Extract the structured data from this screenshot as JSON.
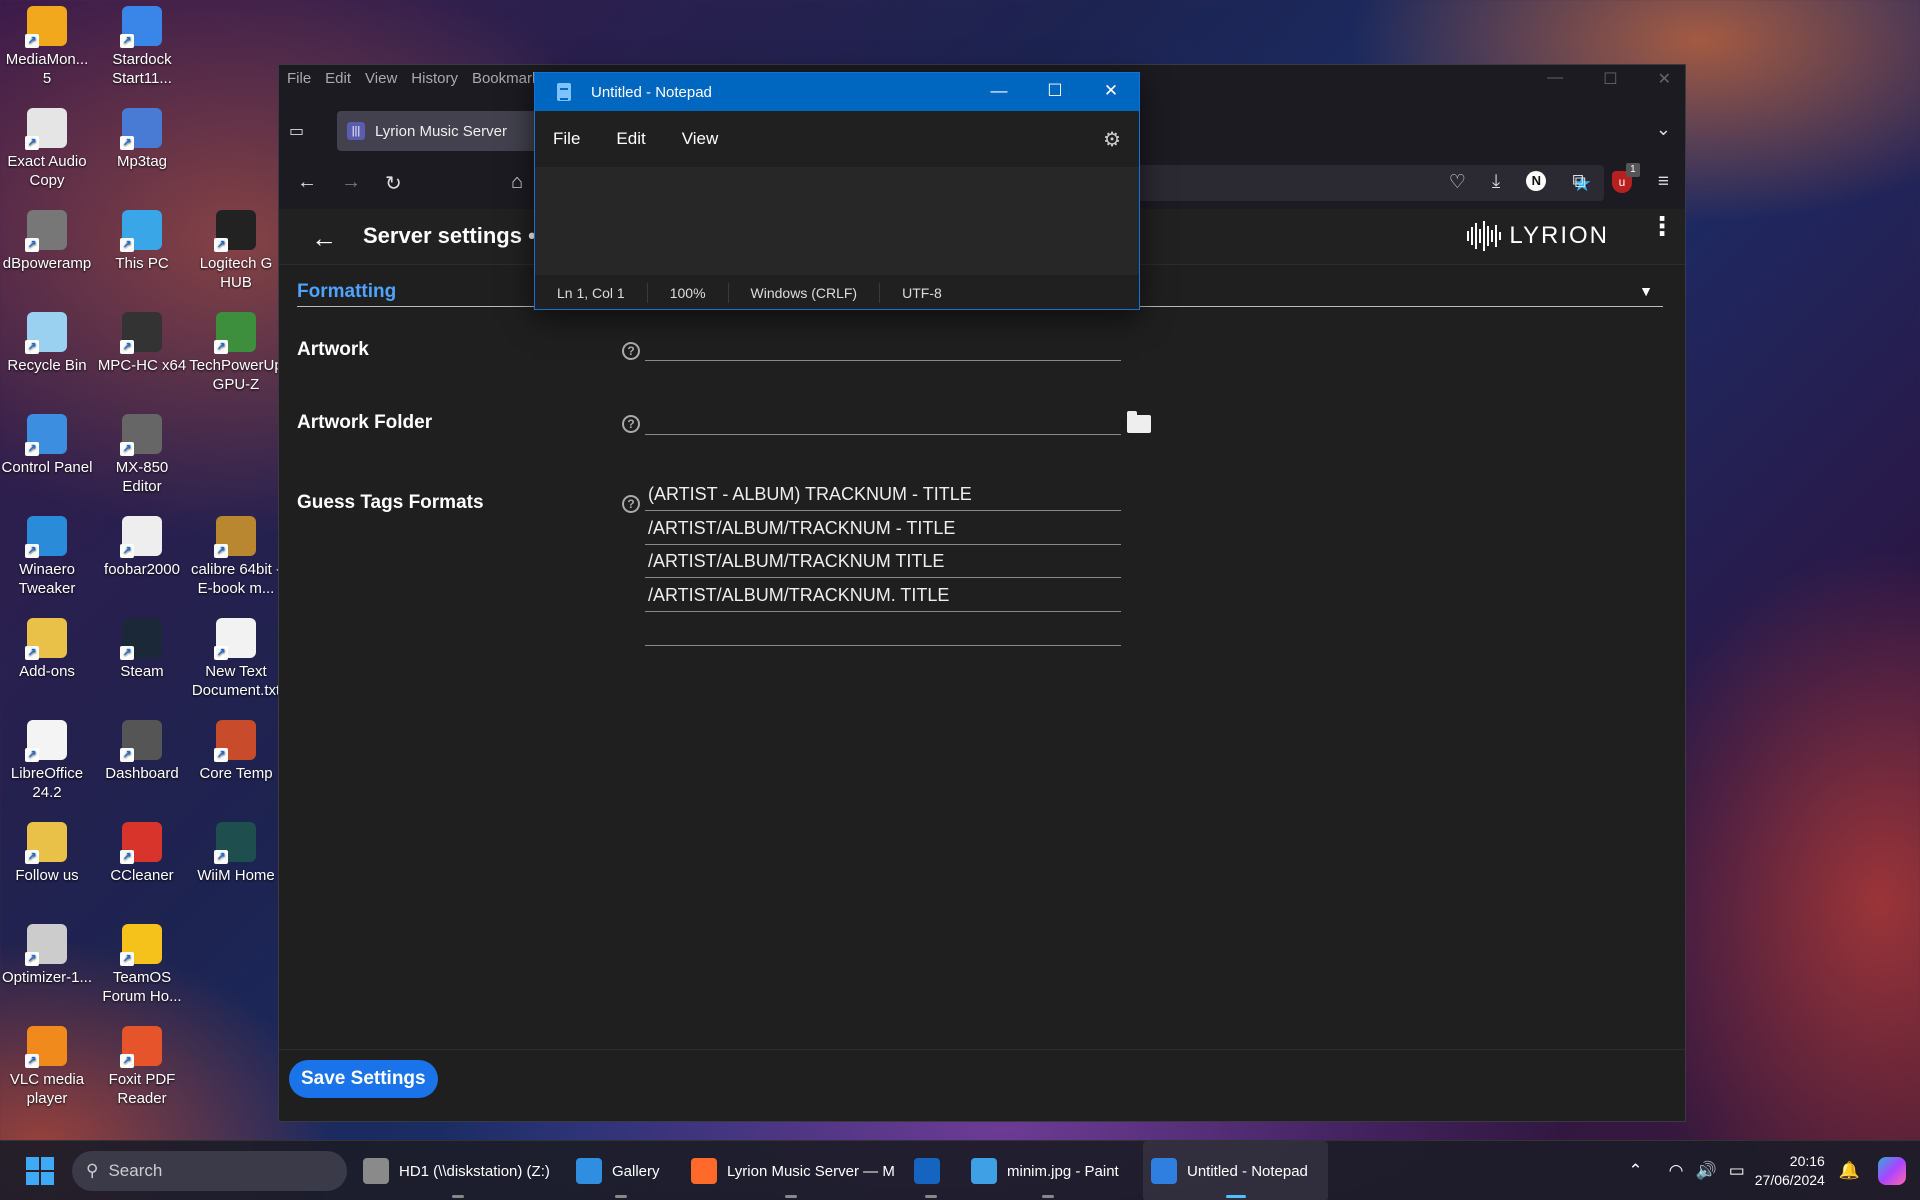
{
  "desktop": {
    "icons": [
      {
        "label": "MediaMon...\n5",
        "name": "mediamonkey",
        "color": "#f2a81d"
      },
      {
        "label": "Stardock Start11...",
        "name": "stardock-start11",
        "color": "#3a86e8"
      },
      {
        "label": "Exact Audio Copy",
        "name": "exact-audio-copy",
        "color": "#e5e5e5"
      },
      {
        "label": "Mp3tag",
        "name": "mp3tag",
        "color": "#4a7bd4"
      },
      {
        "label": "dBpoweramp",
        "name": "dbpoweramp",
        "color": "#777"
      },
      {
        "label": "This PC",
        "name": "this-pc",
        "color": "#39a6e8"
      },
      {
        "label": "Logitech G HUB",
        "name": "logitech-g-hub",
        "color": "#222"
      },
      {
        "label": "Recycle Bin",
        "name": "recycle-bin",
        "color": "#9ad0f0"
      },
      {
        "label": "MPC-HC x64",
        "name": "mpc-hc",
        "color": "#333"
      },
      {
        "label": "TechPowerUp GPU-Z",
        "name": "gpu-z",
        "color": "#3d8f3d"
      },
      {
        "label": "Control Panel",
        "name": "control-panel",
        "color": "#3b8ee0"
      },
      {
        "label": "MX-850 Editor",
        "name": "mx-850-editor",
        "color": "#666"
      },
      {
        "label": "Winaero Tweaker",
        "name": "winaero-tweaker",
        "color": "#2a8bd8"
      },
      {
        "label": "foobar2000",
        "name": "foobar2000",
        "color": "#eee"
      },
      {
        "label": "calibre 64bit - E-book m...",
        "name": "calibre",
        "color": "#b8872f"
      },
      {
        "label": "Add-ons",
        "name": "add-ons",
        "color": "#e9c048"
      },
      {
        "label": "Steam",
        "name": "steam",
        "color": "#1b2838"
      },
      {
        "label": "New Text Document.txt",
        "name": "new-text-document",
        "color": "#f2f2f2"
      },
      {
        "label": "LibreOffice 24.2",
        "name": "libreoffice",
        "color": "#f4f4f4"
      },
      {
        "label": "Dashboard",
        "name": "dashboard",
        "color": "#555"
      },
      {
        "label": "Core Temp",
        "name": "core-temp",
        "color": "#c84b2b"
      },
      {
        "label": "Follow us",
        "name": "follow-us",
        "color": "#e9c048"
      },
      {
        "label": "CCleaner",
        "name": "ccleaner",
        "color": "#d9342b"
      },
      {
        "label": "WiiM Home",
        "name": "wiim-home",
        "color": "#1f4e4e"
      },
      {
        "label": "Optimizer-1...",
        "name": "optimizer",
        "color": "#ccc"
      },
      {
        "label": "TeamOS Forum Ho...",
        "name": "teamos",
        "color": "#f4c21a"
      },
      {
        "label": "VLC media player",
        "name": "vlc",
        "color": "#f08a1c"
      },
      {
        "label": "Foxit PDF Reader",
        "name": "foxit",
        "color": "#e6542b"
      }
    ]
  },
  "browser": {
    "menu": [
      "File",
      "Edit",
      "View",
      "History",
      "Bookmarks"
    ],
    "tab_title": "Lyrion Music Server",
    "page": {
      "title": "Server settings •",
      "logo_text": "LYRION",
      "section": "Formatting",
      "settings": {
        "artwork_label": "Artwork",
        "artwork_value": "",
        "artwork_folder_label": "Artwork Folder",
        "artwork_folder_value": "",
        "guess_tags_label": "Guess Tags Formats",
        "guess_tags_values": [
          "(ARTIST - ALBUM) TRACKNUM - TITLE",
          "/ARTIST/ALBUM/TRACKNUM - TITLE",
          "/ARTIST/ALBUM/TRACKNUM TITLE",
          "/ARTIST/ALBUM/TRACKNUM. TITLE",
          ""
        ]
      },
      "save_label": "Save Settings"
    }
  },
  "notepad": {
    "title": "Untitled - Notepad",
    "menu": [
      "File",
      "Edit",
      "View"
    ],
    "status": {
      "position": "Ln 1, Col 1",
      "zoom": "100%",
      "line_ending": "Windows (CRLF)",
      "encoding": "UTF-8"
    }
  },
  "taskbar": {
    "search_label": "Search",
    "items": [
      {
        "label": "HD1 (\\\\diskstation) (Z:)",
        "name": "hd1-drive",
        "color": "#8a8a8a"
      },
      {
        "label": "Gallery",
        "name": "gallery",
        "color": "#2f8ee0"
      },
      {
        "label": "Lyrion Music Server — M",
        "name": "firefox-lyrion",
        "color": "#ff6a2a"
      },
      {
        "label": "",
        "name": "outlook-new",
        "color": "#1565c0"
      },
      {
        "label": "minim.jpg - Paint",
        "name": "paint",
        "color": "#3fa0e6"
      },
      {
        "label": "Untitled - Notepad",
        "name": "notepad",
        "color": "#2f7fe0"
      }
    ],
    "clock_time": "20:16",
    "clock_date": "27/06/2024"
  },
  "colors": {
    "accent_blue": "#1a73e8",
    "section_blue": "#4ea3ff",
    "notepad_titlebar": "#0067c0"
  }
}
